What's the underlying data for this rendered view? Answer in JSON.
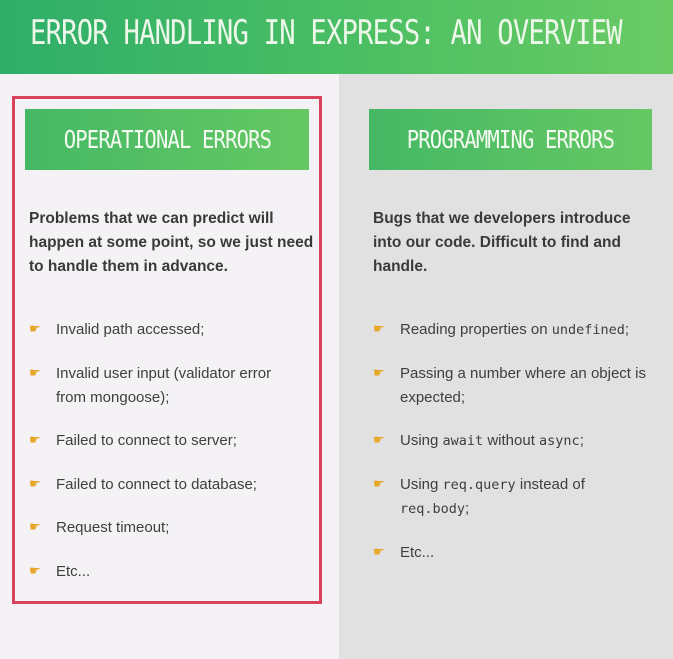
{
  "header": {
    "title": "ERROR HANDLING IN EXPRESS: AN OVERVIEW"
  },
  "operational": {
    "title": "OPERATIONAL ERRORS",
    "intro": "Problems that we can predict will happen at some point, so we just need to handle them in advance.",
    "items": [
      "Invalid path accessed;",
      "Invalid user input (validator error from mongoose);",
      "Failed to connect to server;",
      "Failed to connect to database;",
      "Request timeout;",
      "Etc..."
    ]
  },
  "programming": {
    "title": "PROGRAMMING ERRORS",
    "intro": "Bugs that we developers introduce into our code. Difficult to find and handle.",
    "items": [
      {
        "a": "Reading properties on ",
        "code": "undefined",
        "b": ";"
      },
      {
        "a": "Passing a number where an object is expected;"
      },
      {
        "a": "Using ",
        "code": "await",
        "b": " without ",
        "code2": "async",
        "c": ";"
      },
      {
        "a": "Using ",
        "code": "req.query",
        "b": " instead of ",
        "code2": "req.body",
        "c": ";"
      },
      {
        "a": "Etc..."
      }
    ]
  },
  "icons": {
    "bullet": "pointing-hand-icon"
  },
  "colors": {
    "header_green": "#3cb563",
    "highlight_border": "#d8425a",
    "left_bg": "#f4f2f5",
    "right_bg": "#e1e1e1",
    "bullet_hand": "#e8a629"
  }
}
